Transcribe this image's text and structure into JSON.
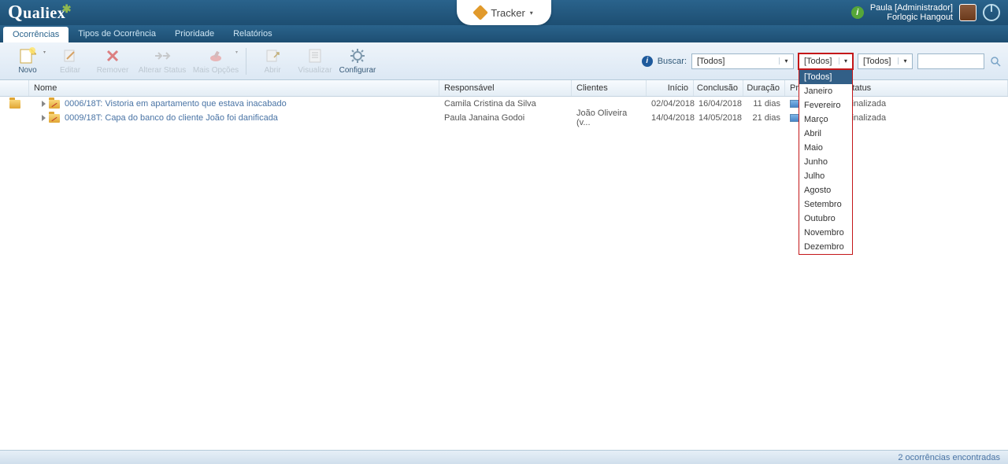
{
  "header": {
    "logo": "Qualiex",
    "tracker": "Tracker",
    "user_name": "Paula [Administrador]",
    "user_company": "Forlogic Hangout"
  },
  "nav": {
    "tabs": [
      "Ocorrências",
      "Tipos de Ocorrência",
      "Prioridade",
      "Relatórios"
    ]
  },
  "toolbar": {
    "novo": "Novo",
    "editar": "Editar",
    "remover": "Remover",
    "alterar_status": "Alterar Status",
    "mais_opcoes": "Mais Opções",
    "abrir": "Abrir",
    "visualizar": "Visualizar",
    "configurar": "Configurar"
  },
  "search": {
    "label": "Buscar:",
    "combo1": "[Todos]",
    "combo_month": "[Todos]",
    "combo3": "[Todos]"
  },
  "columns": {
    "nome": "Nome",
    "responsavel": "Responsável",
    "clientes": "Clientes",
    "inicio": "Início",
    "conclusao": "Conclusão",
    "duracao": "Duração",
    "progresso": "Progresso",
    "status": "Status"
  },
  "rows": [
    {
      "nome": "0006/18T: Vistoria em apartamento que estava inacabado",
      "responsavel": "Camila Cristina da Silva",
      "clientes": "",
      "inicio": "02/04/2018",
      "conclusao": "16/04/2018",
      "duracao": "11 dias",
      "status": "Finalizada"
    },
    {
      "nome": "0009/18T: Capa do banco do cliente João foi danificada",
      "responsavel": "Paula Janaina Godoi",
      "clientes": "João Oliveira (v...",
      "inicio": "14/04/2018",
      "conclusao": "14/05/2018",
      "duracao": "21 dias",
      "status": "Finalizada"
    }
  ],
  "dropdown_months": [
    "[Todos]",
    "Janeiro",
    "Fevereiro",
    "Março",
    "Abril",
    "Maio",
    "Junho",
    "Julho",
    "Agosto",
    "Setembro",
    "Outubro",
    "Novembro",
    "Dezembro"
  ],
  "statusbar": "2 ocorrências encontradas"
}
